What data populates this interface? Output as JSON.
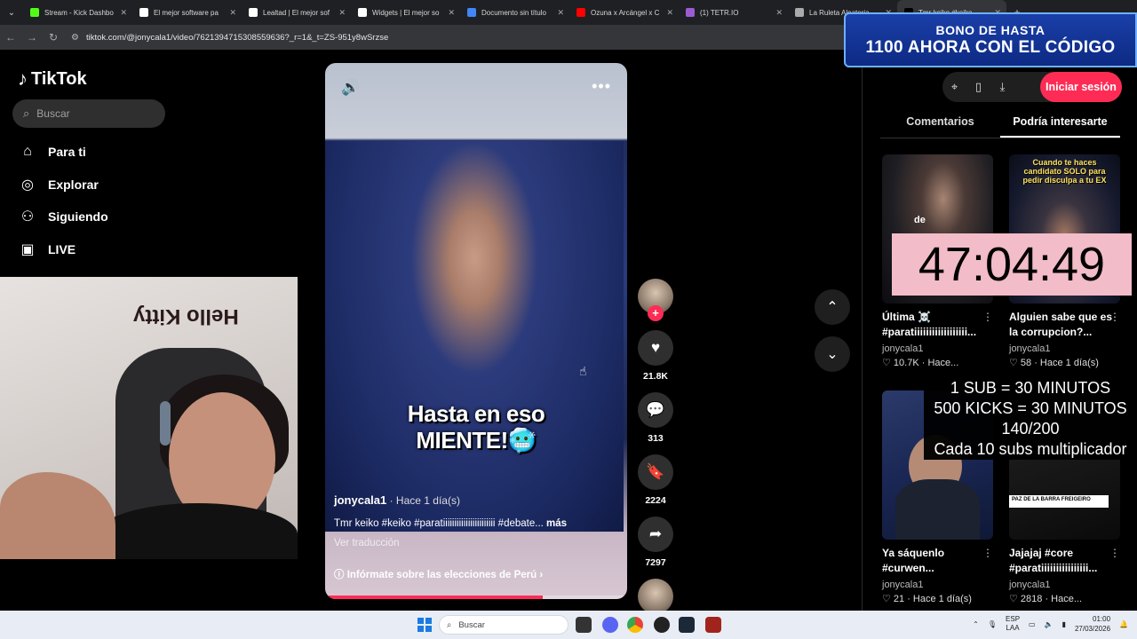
{
  "browser": {
    "tabs": [
      {
        "title": "Stream - Kick Dashbo",
        "color": "#53fc18"
      },
      {
        "title": "El mejor software pa",
        "color": "#ffffff"
      },
      {
        "title": "Lealtad | El mejor sof",
        "color": "#ffffff"
      },
      {
        "title": "Widgets | El mejor so",
        "color": "#ffffff"
      },
      {
        "title": "Documento sin título",
        "color": "#4285f4"
      },
      {
        "title": "Ozuna x Arcángel x C",
        "color": "#ff0000"
      },
      {
        "title": "(1) TETR.IO",
        "color": "#9d5bd2"
      },
      {
        "title": "La Ruleta Aleatoria",
        "color": "#aaaaaa"
      },
      {
        "title": "Tmr keiko #keiko",
        "color": "#000000"
      }
    ],
    "url": "tiktok.com/@jonycala1/video/7621394715308559636?_r=1&_t=ZS-951y8wSrzse"
  },
  "sidebar": {
    "logo": "TikTok",
    "search_placeholder": "Buscar",
    "items": [
      {
        "label": "Para ti",
        "icon": "home-icon"
      },
      {
        "label": "Explorar",
        "icon": "compass-icon"
      },
      {
        "label": "Siguiendo",
        "icon": "user-icon"
      },
      {
        "label": "LIVE",
        "icon": "live-tv-icon"
      }
    ]
  },
  "video": {
    "caption_line1": "Hasta en eso",
    "caption_line2": "MIENTE!🥶",
    "username": "jonycala1",
    "time": " · Hace 1 día(s)",
    "description": "Tmr keiko #keiko #paratiiiiiiiiiiiiiiiiiiiiiii #debate...",
    "more": "más",
    "translate": "Ver traducción",
    "info": "Infórmate sobre las elecciones de Perú",
    "progress": 0.72
  },
  "actions": {
    "likes": "21.8K",
    "comments": "313",
    "saves": "2224",
    "shares": "7297"
  },
  "right": {
    "login": "Iniciar sesión",
    "tab_comments": "Comentarios",
    "tab_interest": "Podría interesarte",
    "cards": [
      {
        "title": "Última ☠️ #paratiiiiiiiiiiiiiiiiii...",
        "user": "jonycala1",
        "meta": "♡ 10.7K · Hace...",
        "overlay": "de"
      },
      {
        "title": "Alguien sabe que es la corrupcion?...",
        "user": "jonycala1",
        "meta": "♡ 58 · Hace 1 día(s)",
        "overlay": "Cuando te haces candidato SOLO para pedir disculpa a tu EX"
      },
      {
        "title": "Ya sáquenlo #curwen...",
        "user": "jonycala1",
        "meta": "♡ 21 · Hace 1 día(s)",
        "overlay": ""
      },
      {
        "title": "Jajajaj #core #paratiiiiiiiiiiiiiiii...",
        "user": "jonycala1",
        "meta": "♡ 2818 · Hace...",
        "overlay": "PAZ DE LA BARRA FREIGEIRO"
      }
    ]
  },
  "overlays": {
    "bono_line1": "BONO DE HASTA",
    "bono_line2": "1100 AHORA CON EL CÓDIGO",
    "timer": "47:04:49",
    "rules": [
      "1 SUB     = 30 MINUTOS",
      "500 KICKS = 30 MINUTOS",
      "140/200",
      "Cada 10 subs multiplicador"
    ],
    "cam_sign": "Hello Kitty"
  },
  "taskbar": {
    "search": "Buscar",
    "lang1": "ESP",
    "lang2": "LAA",
    "time": "01:00",
    "date": "27/03/2026"
  }
}
